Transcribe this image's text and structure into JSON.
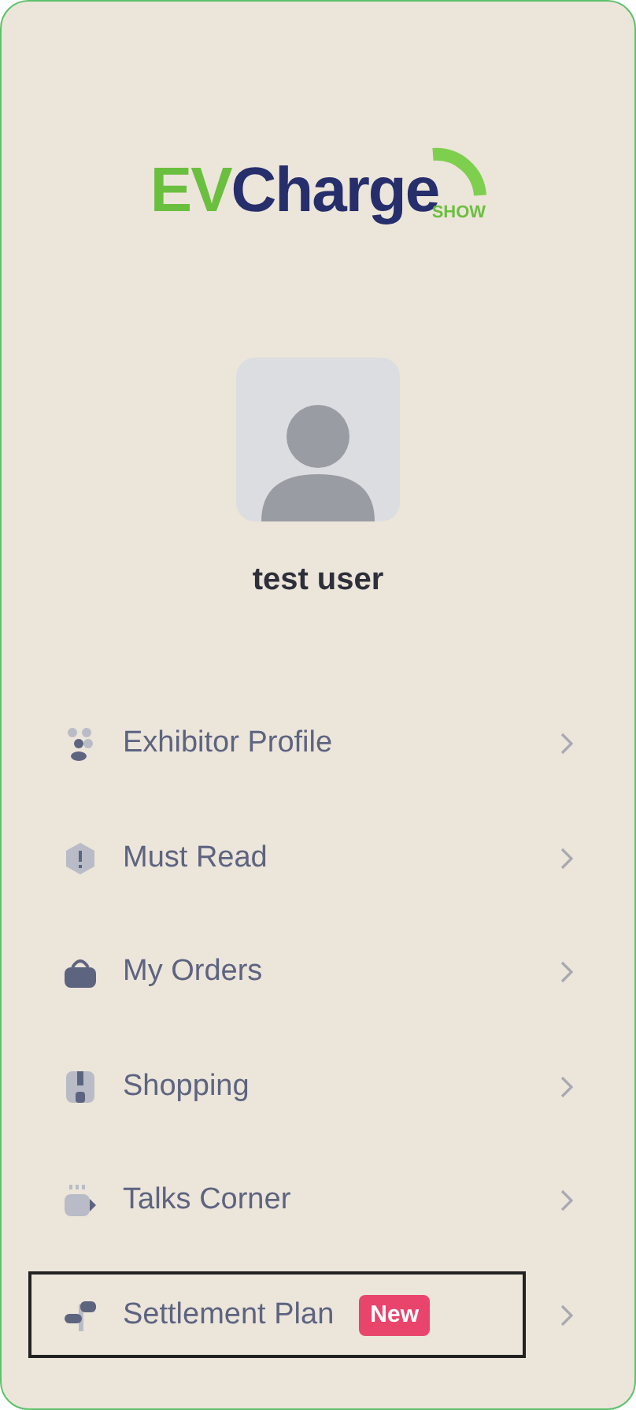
{
  "logo": {
    "ev": "EV",
    "charge": "Charge",
    "show": "SHOW"
  },
  "user": {
    "name": "test user"
  },
  "menu": [
    {
      "kind": "exhibitor",
      "label": "Exhibitor Profile",
      "selected": false
    },
    {
      "kind": "alert",
      "label": "Must Read",
      "selected": false
    },
    {
      "kind": "bag",
      "label": "My Orders",
      "selected": false
    },
    {
      "kind": "shop",
      "label": "Shopping",
      "selected": false
    },
    {
      "kind": "cup",
      "label": "Talks Corner",
      "selected": false
    },
    {
      "kind": "sign",
      "label": "Settlement Plan",
      "badge": "New",
      "selected": true
    }
  ]
}
